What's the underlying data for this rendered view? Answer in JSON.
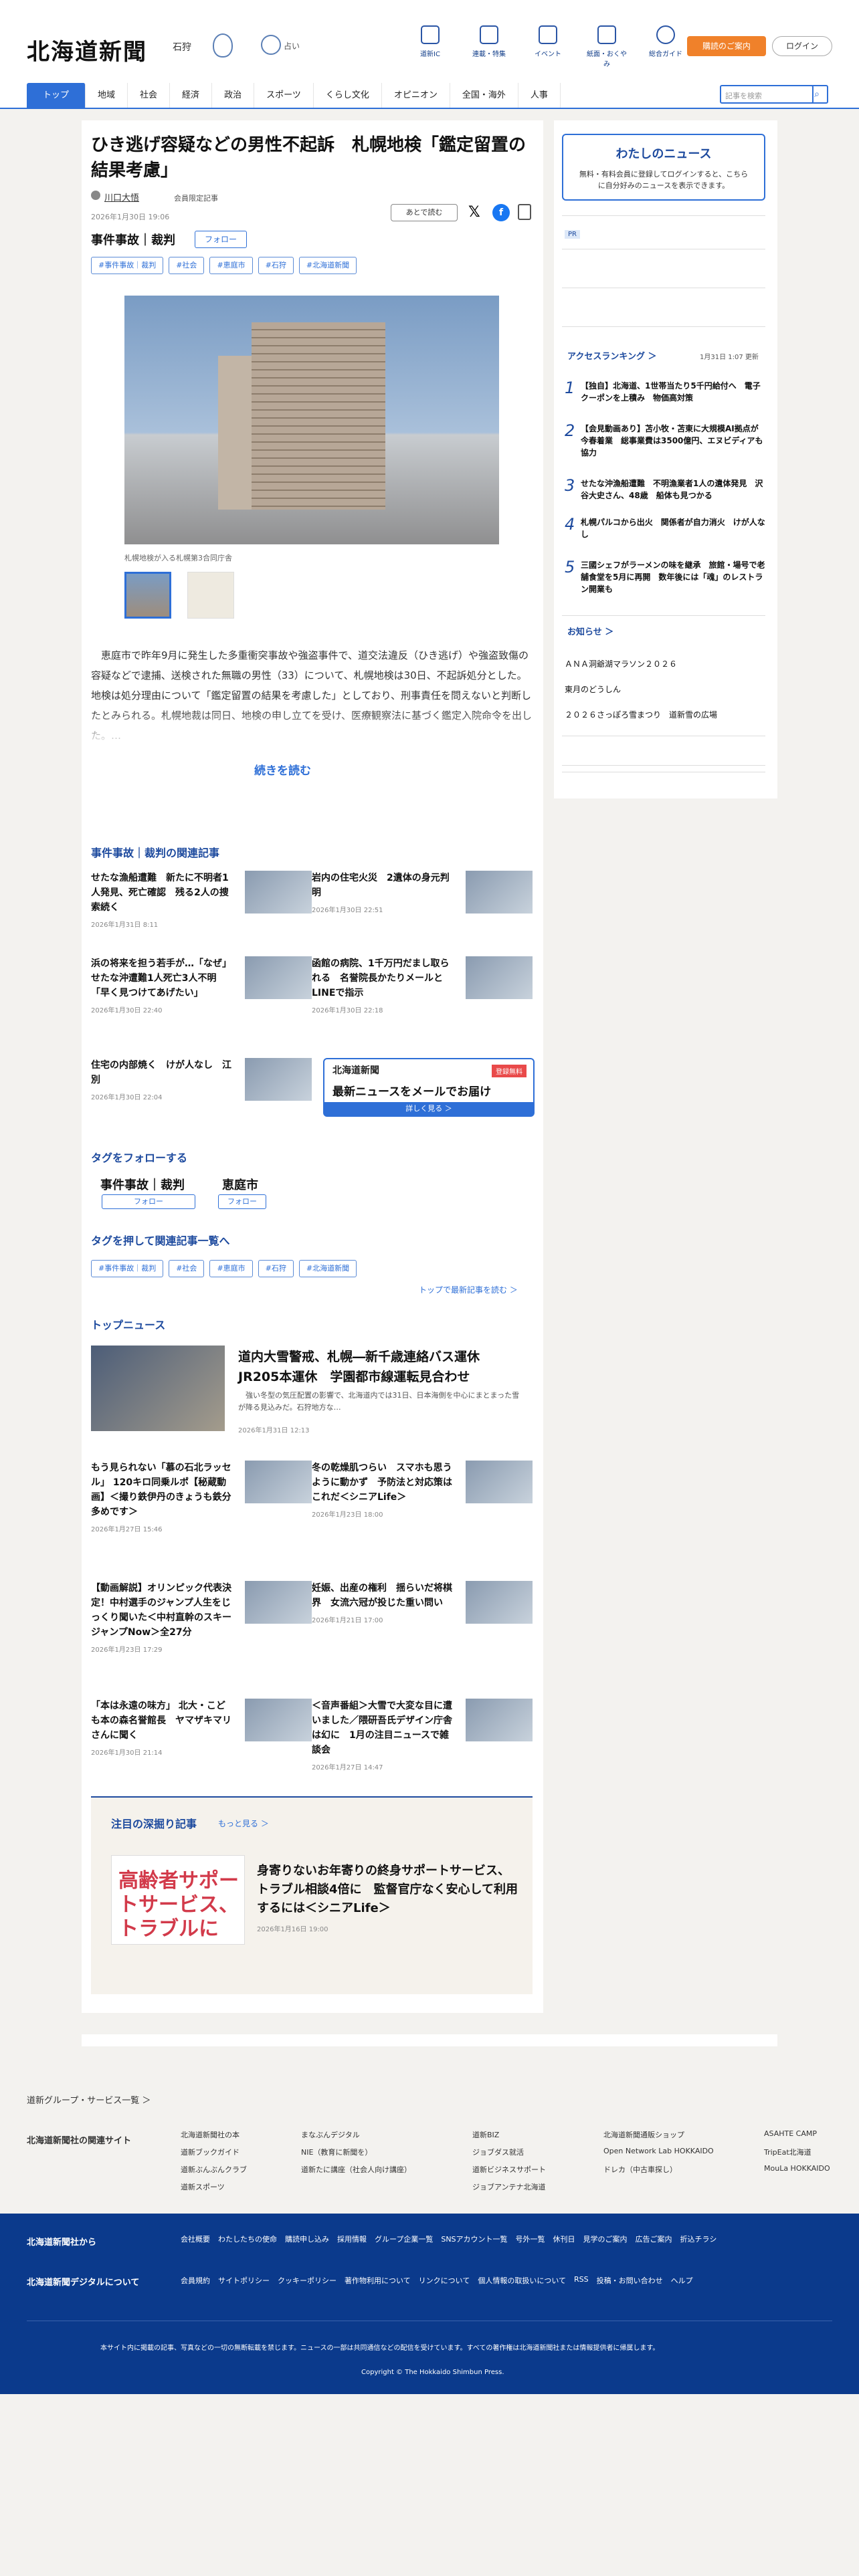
{
  "header": {
    "logo": "北海道新聞",
    "region": "石狩",
    "temp": "占い",
    "icons": [
      "道新IC",
      "連載・特集",
      "イベント",
      "紙面・おくやみ",
      "総合ガイド"
    ],
    "btn_orange": "購読のご案内",
    "btn_login": "ログイン"
  },
  "nav": {
    "tabs": [
      "トップ",
      "地域",
      "社会",
      "経済",
      "政治",
      "スポーツ",
      "くらし文化",
      "オピニオン",
      "全国・海外",
      "人事"
    ],
    "search_placeholder": "記事を検索",
    "search_icon": "magnifier-icon"
  },
  "article": {
    "headline": "ひき逃げ容疑などの男性不起訴　札幌地検「鑑定留置の結果考慮」",
    "author": "川口大悟",
    "limited": "会員限定記事",
    "date": "2026年1月30日 19:06",
    "read_later": "あとで読む",
    "category": "事件事故｜裁判",
    "follow": "フォロー",
    "tags": [
      "#事件事故｜裁判",
      "#社会",
      "#恵庭市",
      "#石狩",
      "#北海道新聞"
    ],
    "caption": "札幌地検が入る札幌第3合同庁舎",
    "body": "　恵庭市で昨年9月に発生した多重衝突事故や強盗事件で、道交法違反（ひき逃げ）や強盗致傷の容疑などで逮捕、送検された無職の男性（33）について、札幌地検は30日、不起訴処分とした。地検は処分理由について「鑑定留置の結果を考慮した」としており、刑事責任を問えないと判断したとみられる。札幌地裁は同日、地検の申し立てを受け、医療観察法に基づく鑑定入院命令を出した。…",
    "read_more": "続きを読む"
  },
  "related": {
    "heading": "事件事故｜裁判の関連記事",
    "items": [
      {
        "title": "せたな漁船遭難　新たに不明者1人発見、死亡確認　残る2人の捜索続く",
        "date": "2026年1月31日 8:11"
      },
      {
        "title": "岩内の住宅火災　2遺体の身元判明",
        "date": "2026年1月30日 22:51"
      },
      {
        "title": "浜の将来を担う若手が…「なぜ」 せたな沖遭難1人死亡3人不明「早く見つけてあげたい」",
        "date": "2026年1月30日 22:40"
      },
      {
        "title": "函館の病院、1千万円だまし取られる　名誉院長かたりメールとLINEで指示",
        "date": "2026年1月30日 22:18"
      },
      {
        "title": "住宅の内部焼く　けが人なし　江別",
        "date": "2026年1月30日 22:04"
      }
    ],
    "mail_logo": "北海道新聞",
    "mail_badge": "登録無料",
    "mail_main": "最新ニュースをメールでお届け",
    "mail_btn": "詳しく見る ＞"
  },
  "follow_tags": {
    "heading": "タグをフォローする",
    "names": [
      "事件事故｜裁判",
      "恵庭市"
    ],
    "btn": "フォロー"
  },
  "tag_list": {
    "heading": "タグを押して関連記事一覧へ",
    "tags": [
      "#事件事故｜裁判",
      "#社会",
      "#恵庭市",
      "#石狩",
      "#北海道新聞"
    ],
    "top_link": "トップで最新記事を読む ＞"
  },
  "top_news": {
    "heading": "トップニュース",
    "feature": {
      "title": "道内大雪警戒、札幌―新千歳連絡バス運休　JR205本運休　学園都市線運転見合わせ",
      "sub": "　強い冬型の気圧配置の影響で、北海道内では31日、日本海側を中心にまとまった雪が降る見込みだ。石狩地方な…",
      "date": "2026年1月31日 12:13"
    },
    "items": [
      {
        "title": "もう見られない「慕の石北ラッセル」 120キロ同乗ルポ【秘蔵動画】＜撮り鉄伊丹のきょうも鉄分多めです＞",
        "date": "2026年1月27日 15:46"
      },
      {
        "title": "冬の乾燥肌つらい　スマホも思うように動かず　予防法と対応策はこれだ＜シニアLife＞",
        "date": "2026年1月23日 18:00"
      },
      {
        "title": "【動画解説】オリンピック代表決定！中村選手のジャンプ人生をじっくり聞いた＜中村直幹のスキージャンプNow＞全27分",
        "date": "2026年1月23日 17:29"
      },
      {
        "title": "妊娠、出産の権利　揺らいだ将棋界　女流六冠が投じた重い問い",
        "date": "2026年1月21日 17:00"
      },
      {
        "title": "「本は永遠の味方」 北大・こども本の森名誉館長　ヤマザキマリさんに聞く",
        "date": "2026年1月30日 21:14"
      },
      {
        "title": "＜音声番組＞大雪で大変な目に遭いました／隈研吾氏デザイン庁舎は幻に　1月の注目ニュースで雑談会",
        "date": "2026年1月27日 14:47"
      }
    ]
  },
  "deep": {
    "heading": "注目の深掘り記事",
    "more": "もっと見る ＞",
    "img_text": "高齢者サポートサービス、トラブルに",
    "title": "身寄りないお年寄りの終身サポートサービス、トラブル相談4倍に　監督官庁なく安心して利用するには＜シニアLife＞",
    "date": "2026年1月16日 19:00"
  },
  "side": {
    "mynews_head": "わたしのニュース",
    "mynews_text": "無料・有料会員に登録してログインすると、こちらに自分好みのニュースを表示できます。",
    "pr": "PR",
    "ranking_head": "アクセスランキング ＞",
    "ranking_date": "1月31日 1:07 更新",
    "ranking": [
      {
        "n": "1",
        "t": "【独自】北海道、1世帯当たり5千円給付へ　電子クーポンを上積み　物価高対策"
      },
      {
        "n": "2",
        "t": "【会見動画あり】苫小牧・苫東に大規模AI拠点が今春着業　総事業費は3500億円、エヌビディアも協力"
      },
      {
        "n": "3",
        "t": "せたな沖漁船遭難　不明漁業者1人の遺体発見　沢谷大史さん、48歳　船体も見つかる"
      },
      {
        "n": "4",
        "t": "札幌パルコから出火　関係者が自力消火　けが人なし"
      },
      {
        "n": "5",
        "t": "三國シェフがラーメンの味を継承　旅館・場号で老舗食堂を5月に再開　数年後には「魂」のレストラン開業も"
      }
    ],
    "notice_head": "お知らせ ＞",
    "notices": [
      "ＡＮＡ洞爺湖マラソン２０２６",
      "東月のどうしん",
      "２０２６さっぽろ雪まつり　道新雪の広場"
    ]
  },
  "footer": {
    "group": "道新グループ・サービス一覧 ＞",
    "related": "北海道新聞社の関連サイト",
    "cols": [
      "北海道新聞社の本",
      "まなぶんデジタル",
      "道新BIZ",
      "北海道新聞通販ショップ",
      "ASAHTE CAMP",
      "道新ブックガイド",
      "NIE（教育に新聞を）",
      "ジョブダス就活",
      "Open Network Lab HOKKAIDO",
      "TripEat北海道",
      "道新ぶんぶんクラブ",
      "道新たに講座（社会人向け講座）",
      "道新ビジネスサポート",
      "ドレカ（中古車探し）",
      "MouLa HOKKAIDO",
      "道新スポーツ",
      "",
      "ジョブアンテナ北海道",
      "",
      ""
    ],
    "blue_h1": "北海道新聞社から",
    "blue_h2": "北海道新聞デジタルについて",
    "blue_l1": [
      "会社概要",
      "わたしたちの使命",
      "購読申し込み",
      "採用情報",
      "グループ企業一覧",
      "SNSアカウント一覧",
      "号外一覧",
      "休刊日",
      "見学のご案内",
      "広告ご案内",
      "折込チラシ"
    ],
    "blue_l2": [
      "会員規約",
      "サイトポリシー",
      "クッキーポリシー",
      "著作物利用について",
      "リンクについて",
      "個人情報の取扱いについて",
      "RSS",
      "投稿・お問い合わせ",
      "ヘルプ"
    ],
    "note": "本サイト内に掲載の記事、写真などの一切の無断転載を禁じます。ニュースの一部は共同通信などの配信を受けています。すべての著作権は北海道新聞社または情報提供者に帰属します。",
    "copyright": "Copyright © The Hokkaido Shimbun Press."
  }
}
